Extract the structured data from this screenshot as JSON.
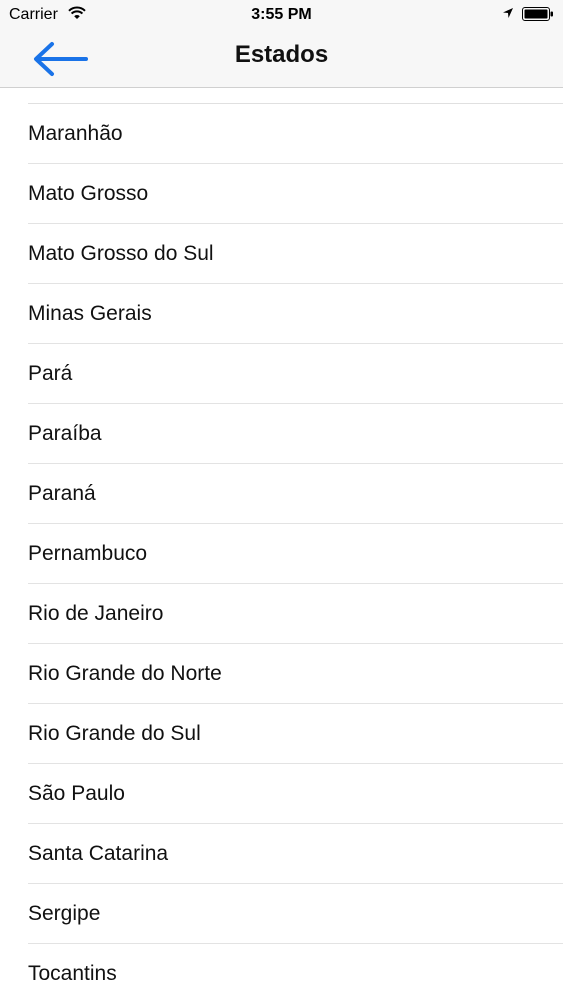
{
  "status_bar": {
    "carrier": "Carrier",
    "time": "3:55 PM"
  },
  "nav": {
    "title": "Estados",
    "back_icon": "arrow-left-icon",
    "accent_color": "#1a73e8"
  },
  "states": [
    "Maranhão",
    "Mato Grosso",
    "Mato Grosso do Sul",
    "Minas Gerais",
    "Pará",
    "Paraíba",
    "Paraná",
    "Pernambuco",
    "Rio de Janeiro",
    "Rio Grande do Norte",
    "Rio Grande do Sul",
    "São Paulo",
    "Santa Catarina",
    "Sergipe",
    "Tocantins"
  ]
}
